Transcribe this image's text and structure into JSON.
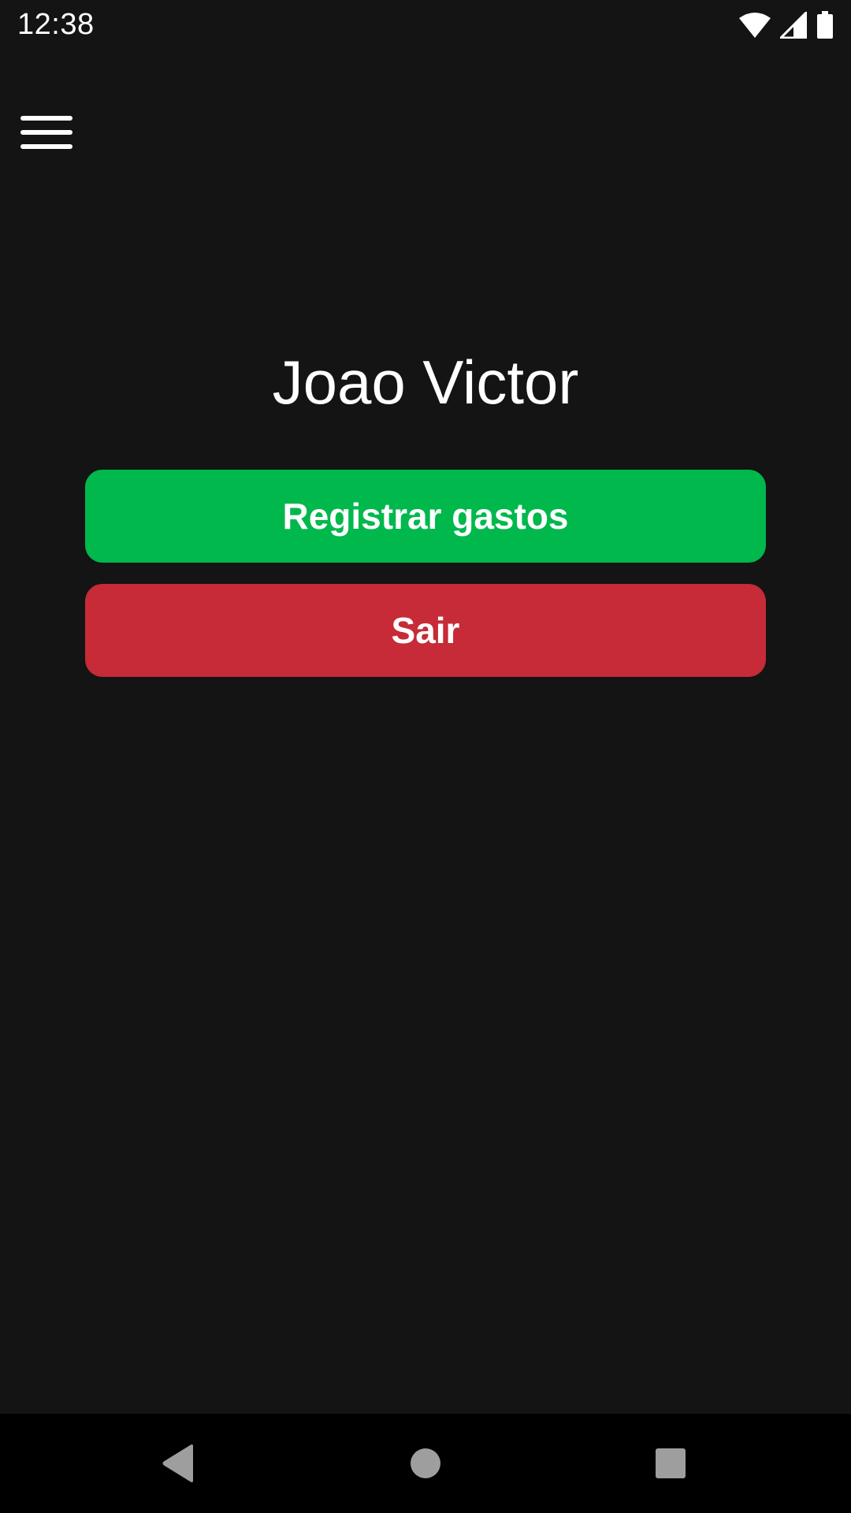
{
  "status_bar": {
    "time": "12:38",
    "icons": [
      "wifi-icon",
      "cellular-signal-icon",
      "battery-icon"
    ]
  },
  "header": {
    "menu_icon": "hamburger-menu-icon"
  },
  "profile": {
    "name": "Joao Victor"
  },
  "actions": {
    "register_label": "Registrar gastos",
    "exit_label": "Sair"
  },
  "nav_bar": {
    "icons": [
      "back-icon",
      "home-icon",
      "recents-icon"
    ]
  },
  "colors": {
    "background": "#141414",
    "register_button": "#00b84c",
    "exit_button": "#c62b37",
    "text": "#ffffff",
    "nav_bar": "#000000",
    "nav_icons": "#9e9e9e"
  }
}
